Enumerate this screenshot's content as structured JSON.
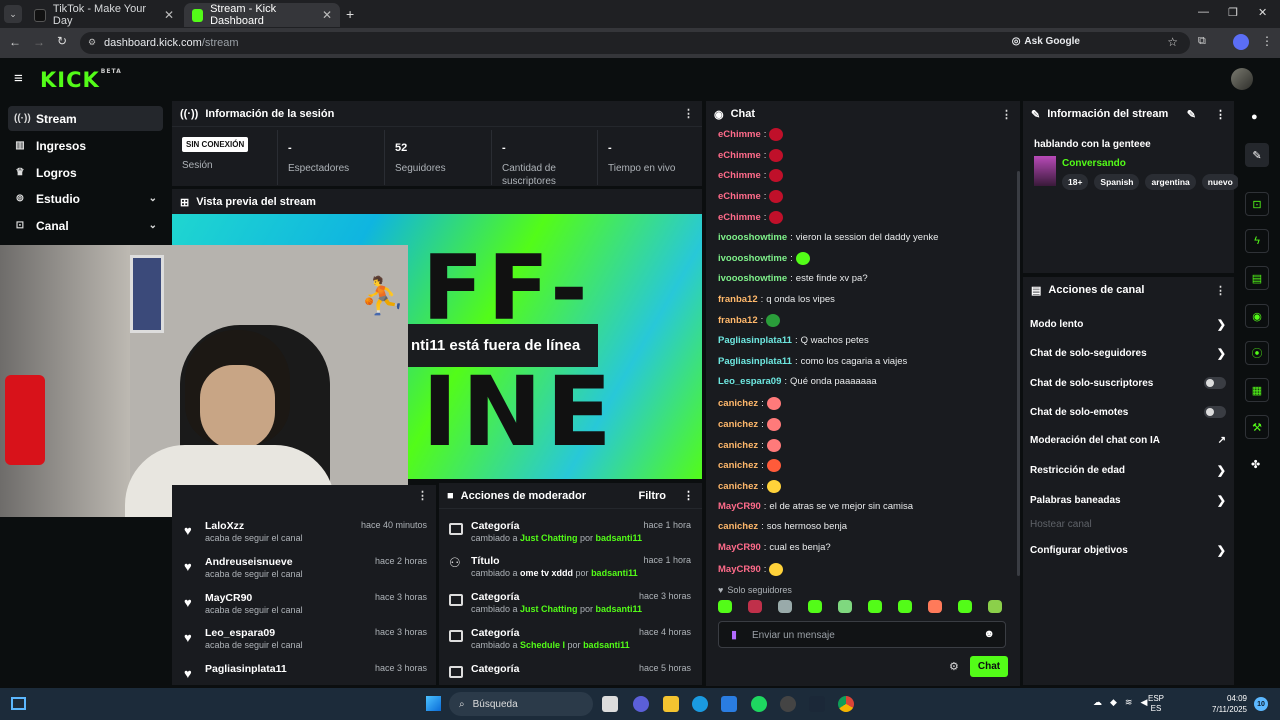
{
  "browser": {
    "tabs": [
      {
        "title": "TikTok - Make Your Day"
      },
      {
        "title": "Stream - Kick Dashboard"
      }
    ],
    "url_host": "dashboard.kick.com",
    "url_path": "/stream",
    "ask_google": "Ask Google"
  },
  "brand": {
    "logo": "KICK",
    "beta": "BETA",
    "accent": "#53fc18"
  },
  "sidebar": {
    "items": [
      {
        "label": "Stream",
        "icon": "radio-icon"
      },
      {
        "label": "Ingresos",
        "icon": "bank-icon"
      },
      {
        "label": "Logros",
        "icon": "trophy-icon"
      },
      {
        "label": "Estudio",
        "icon": "studio-icon"
      },
      {
        "label": "Canal",
        "icon": "channel-icon"
      }
    ]
  },
  "session": {
    "title": "Información de la sesión",
    "badge": "SIN CONEXIÓN",
    "badge_label": "Sesión",
    "stats": [
      {
        "value": "-",
        "label": "Espectadores"
      },
      {
        "value": "52",
        "label": "Seguidores"
      },
      {
        "value": "-",
        "label": "Cantidad de suscriptores"
      },
      {
        "value": "-",
        "label": "Tiempo en vivo"
      }
    ]
  },
  "preview": {
    "title": "Vista previa del stream",
    "offline_text": "nti11 está fuera de línea"
  },
  "feed": [
    {
      "name": "LaloXzz",
      "sub": "acaba de seguir el canal",
      "time": "hace 40 minutos"
    },
    {
      "name": "Andreuseisnueve",
      "sub": "acaba de seguir el canal",
      "time": "hace 2 horas"
    },
    {
      "name": "MayCR90",
      "sub": "acaba de seguir el canal",
      "time": "hace 3 horas"
    },
    {
      "name": "Leo_espara09",
      "sub": "acaba de seguir el canal",
      "time": "hace 3 horas"
    },
    {
      "name": "Pagliasinplata11",
      "sub": "acaba de seguir el canal",
      "time": "hace 3 horas"
    }
  ],
  "mod": {
    "title": "Acciones de moderador",
    "filter": "Filtro",
    "items": [
      {
        "name": "Categoría",
        "pre": "cambiado a ",
        "value": "Just Chatting",
        "by": " por ",
        "user": "badsanti11",
        "time": "hace 1 hora"
      },
      {
        "name": "Título",
        "pre": "cambiado a ",
        "value": "ome tv xddd",
        "by": " por ",
        "user": "badsanti11",
        "time": "hace 1 hora"
      },
      {
        "name": "Categoría",
        "pre": "cambiado a ",
        "value": "Just Chatting",
        "by": " por ",
        "user": "badsanti11",
        "time": "hace 3 horas"
      },
      {
        "name": "Categoría",
        "pre": "cambiado a ",
        "value": "Schedule I",
        "by": " por ",
        "user": "badsanti11",
        "time": "hace 4 horas"
      },
      {
        "name": "Categoría",
        "pre": "",
        "value": "",
        "by": "",
        "user": "",
        "time": "hace 5 horas"
      }
    ]
  },
  "chat": {
    "title": "Chat",
    "messages": [
      {
        "user": "eChimme",
        "color": "#ff6b8a",
        "text": "",
        "emote": "#c0102a"
      },
      {
        "user": "eChimme",
        "color": "#ff6b8a",
        "text": "",
        "emote": "#c0102a"
      },
      {
        "user": "eChimme",
        "color": "#ff6b8a",
        "text": "",
        "emote": "#c0102a"
      },
      {
        "user": "eChimme",
        "color": "#ff6b8a",
        "text": "",
        "emote": "#c0102a"
      },
      {
        "user": "eChimme",
        "color": "#ff6b8a",
        "text": "",
        "emote": "#c0102a"
      },
      {
        "user": "ivoooshowtime",
        "color": "#7ef08a",
        "text": "vieron la session del daddy yenke",
        "emote": ""
      },
      {
        "user": "ivoooshowtime",
        "color": "#7ef08a",
        "text": "",
        "emote": "#53fc18"
      },
      {
        "user": "ivoooshowtime",
        "color": "#7ef08a",
        "text": "este finde xv pa?",
        "emote": ""
      },
      {
        "user": "franba12",
        "color": "#ffb86b",
        "text": "q onda los vipes",
        "emote": ""
      },
      {
        "user": "franba12",
        "color": "#ffb86b",
        "text": "",
        "emote": "#2a9d3a"
      },
      {
        "user": "Pagliasinplata11",
        "color": "#6ee7e0",
        "text": "Q wachos petes",
        "emote": ""
      },
      {
        "user": "Pagliasinplata11",
        "color": "#6ee7e0",
        "text": "como los cagaria a viajes",
        "emote": ""
      },
      {
        "user": "Leo_espara09",
        "color": "#6ee7e0",
        "text": "Qué onda paaaaaaa",
        "emote": ""
      },
      {
        "user": "canichez",
        "color": "#ffb86b",
        "text": "",
        "emote": "#ff7a7a"
      },
      {
        "user": "canichez",
        "color": "#ffb86b",
        "text": "",
        "emote": "#ff7a7a"
      },
      {
        "user": "canichez",
        "color": "#ffb86b",
        "text": "",
        "emote": "#ff7a7a"
      },
      {
        "user": "canichez",
        "color": "#ffb86b",
        "text": "",
        "emote": "#ff5b3a"
      },
      {
        "user": "canichez",
        "color": "#ffb86b",
        "text": "",
        "emote": "#ffd23a"
      },
      {
        "user": "MayCR90",
        "color": "#ff6b8a",
        "text": "el de atras se ve mejor sin camisa",
        "emote": ""
      },
      {
        "user": "canichez",
        "color": "#ffb86b",
        "text": "sos hermoso benja",
        "emote": ""
      },
      {
        "user": "MayCR90",
        "color": "#ff6b8a",
        "text": "cual es benja?",
        "emote": ""
      },
      {
        "user": "MayCR90",
        "color": "#ff6b8a",
        "text": "",
        "emote": "#ffd23a"
      }
    ],
    "followers_only": "Solo seguidores",
    "placeholder": "Enviar un mensaje",
    "send": "Chat"
  },
  "stream_info": {
    "title": "Información del stream",
    "stream_title": "hablando con la genteee",
    "category": "Conversando",
    "tags": [
      "18+",
      "Spanish",
      "argentina",
      "nuevo"
    ]
  },
  "channel_actions": {
    "title": "Acciones de canal",
    "items": [
      {
        "label": "Modo lento",
        "kind": "chevron"
      },
      {
        "label": "Chat de solo-seguidores",
        "kind": "chevron"
      },
      {
        "label": "Chat de solo-suscriptores",
        "kind": "toggle"
      },
      {
        "label": "Chat de solo-emotes",
        "kind": "toggle"
      },
      {
        "label": "Moderación del chat con IA",
        "kind": "link"
      },
      {
        "label": "Restricción de edad",
        "kind": "chevron"
      },
      {
        "label": "Palabras baneadas",
        "kind": "chevron"
      },
      {
        "label": "Hostear canal",
        "kind": "disabled"
      },
      {
        "label": "Configurar objetivos",
        "kind": "chevron"
      }
    ]
  },
  "taskbar": {
    "search": "Búsqueda",
    "lang": "ESP",
    "lang2": "ES",
    "time": "04:09",
    "date": "7/11/2025",
    "notif": "10"
  }
}
